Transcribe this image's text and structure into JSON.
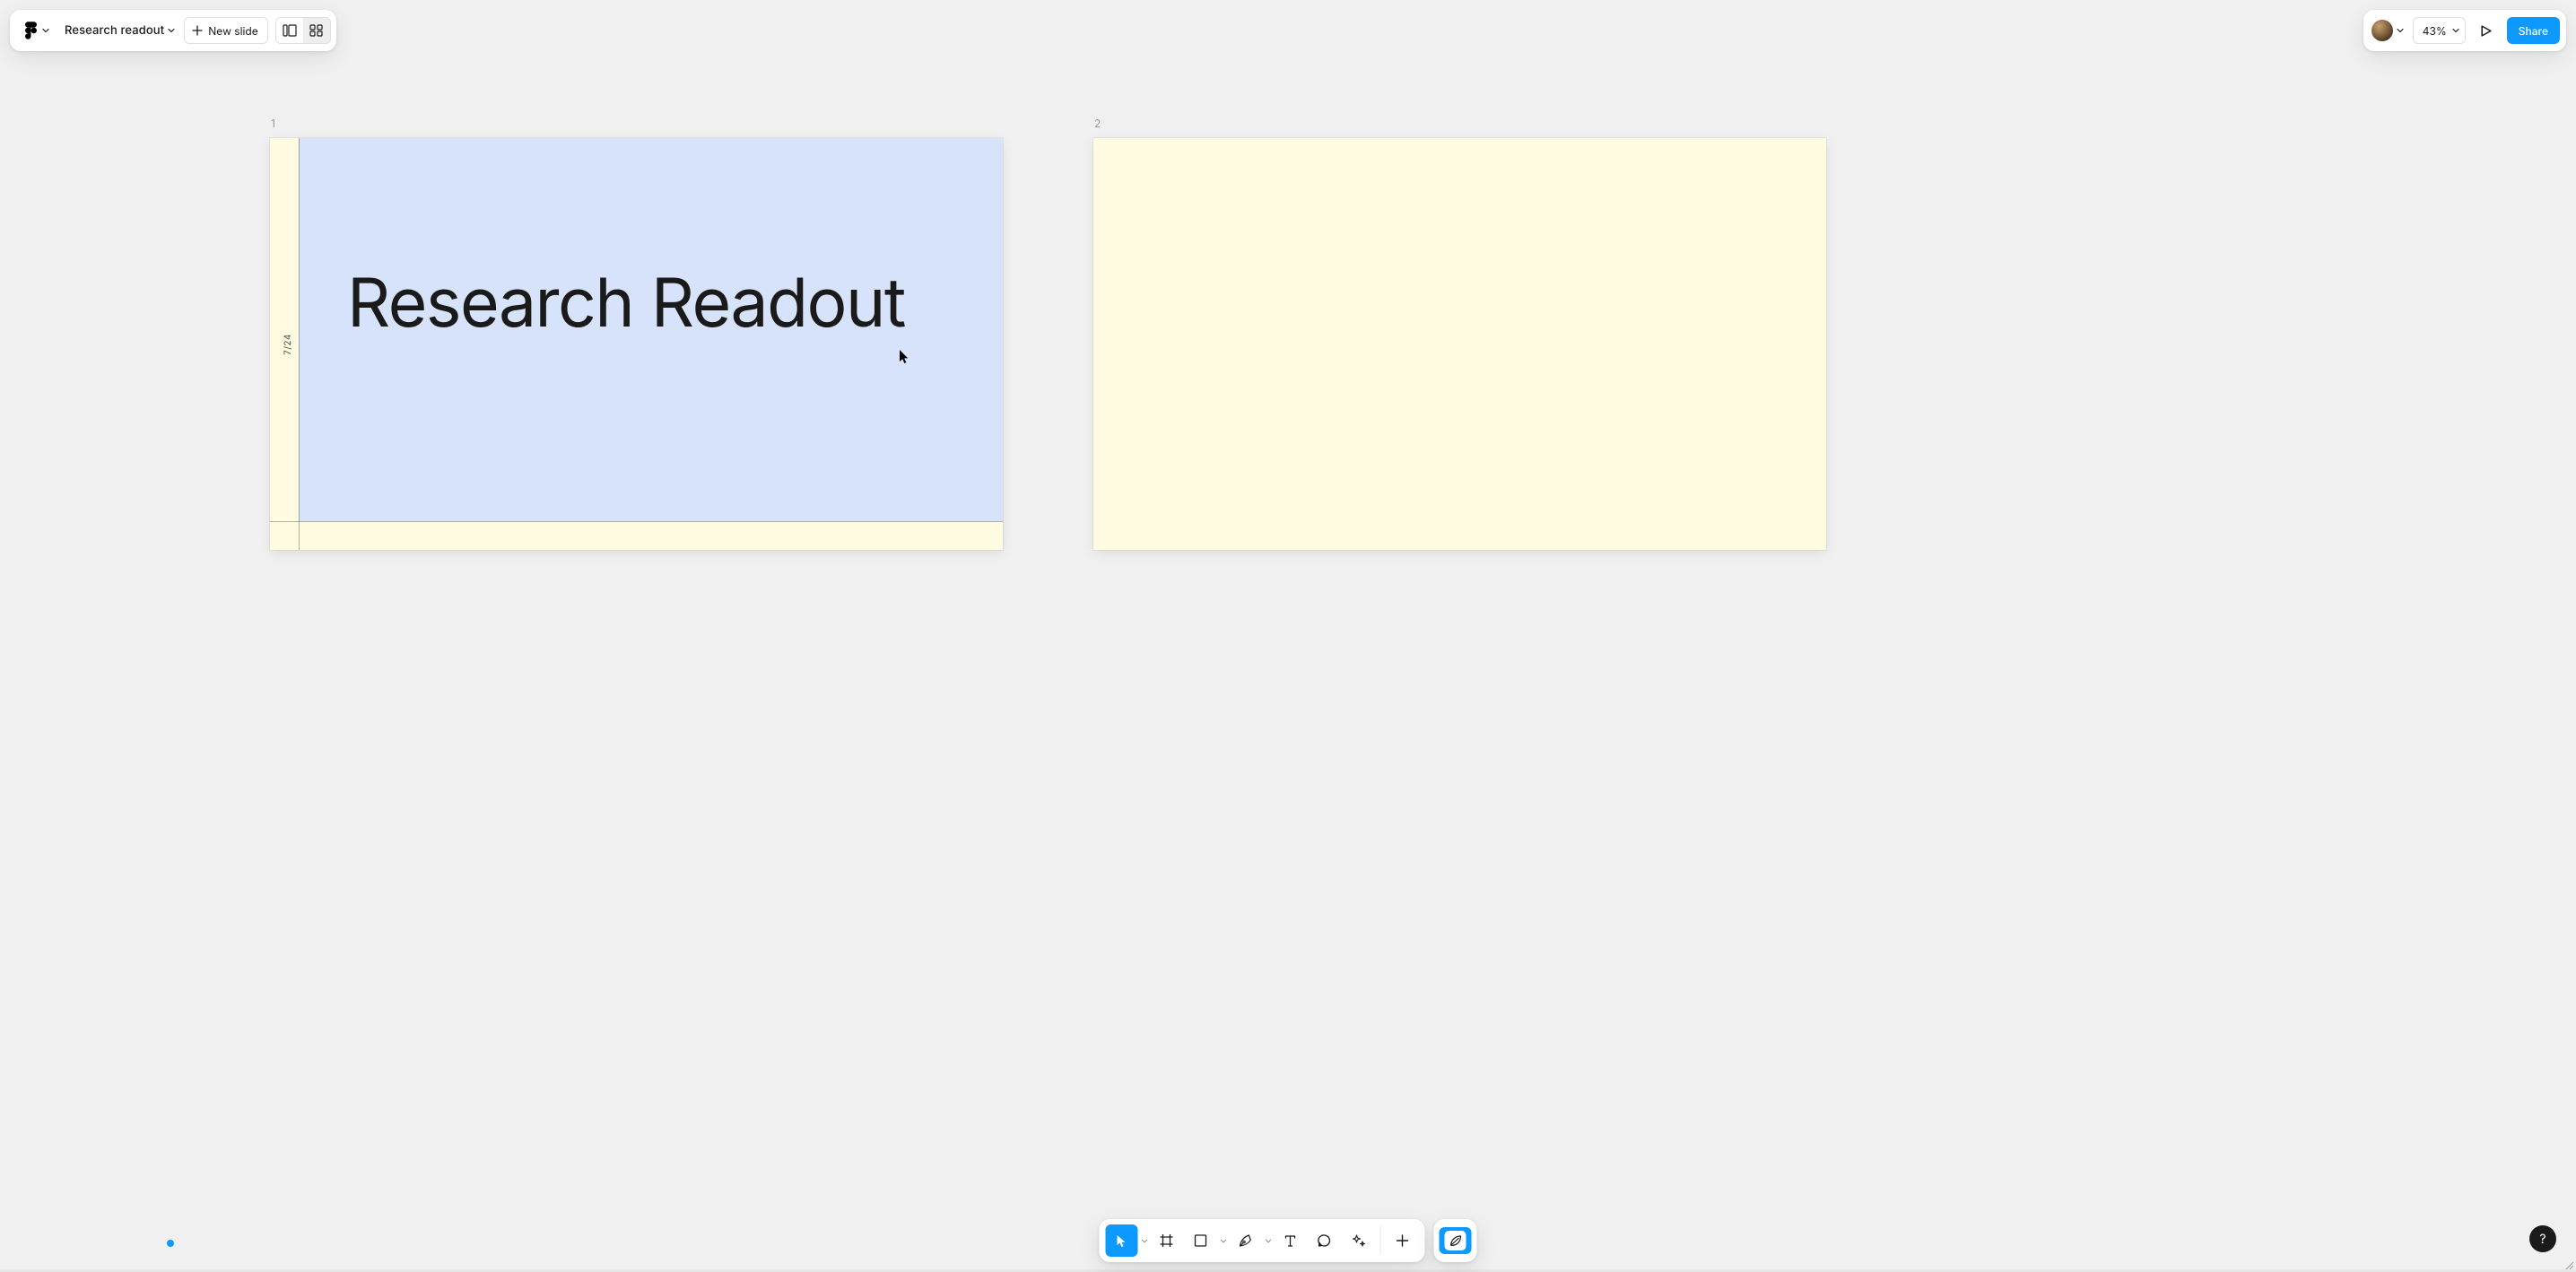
{
  "header": {
    "doc_title": "Research readout",
    "new_slide_label": "New slide",
    "zoom_label": "43%",
    "share_label": "Share"
  },
  "canvas": {
    "slides": [
      {
        "number": "1",
        "title": "Research Readout",
        "date_badge": "7/24"
      },
      {
        "number": "2"
      }
    ]
  },
  "help": {
    "glyph": "?"
  },
  "icons": {
    "figma": "figma-logo",
    "chevron_down": "chevron-down",
    "plus": "plus",
    "panel_single": "single-slide-view",
    "panel_grid": "grid-view",
    "play": "present",
    "cursor": "select-tool",
    "frame": "frame-tool",
    "rect": "shape-tool",
    "pen": "pen-tool",
    "text": "text-tool",
    "comment": "comment-tool",
    "ai": "ai-tool",
    "add": "insert-tool",
    "leaf": "eco-mode"
  }
}
